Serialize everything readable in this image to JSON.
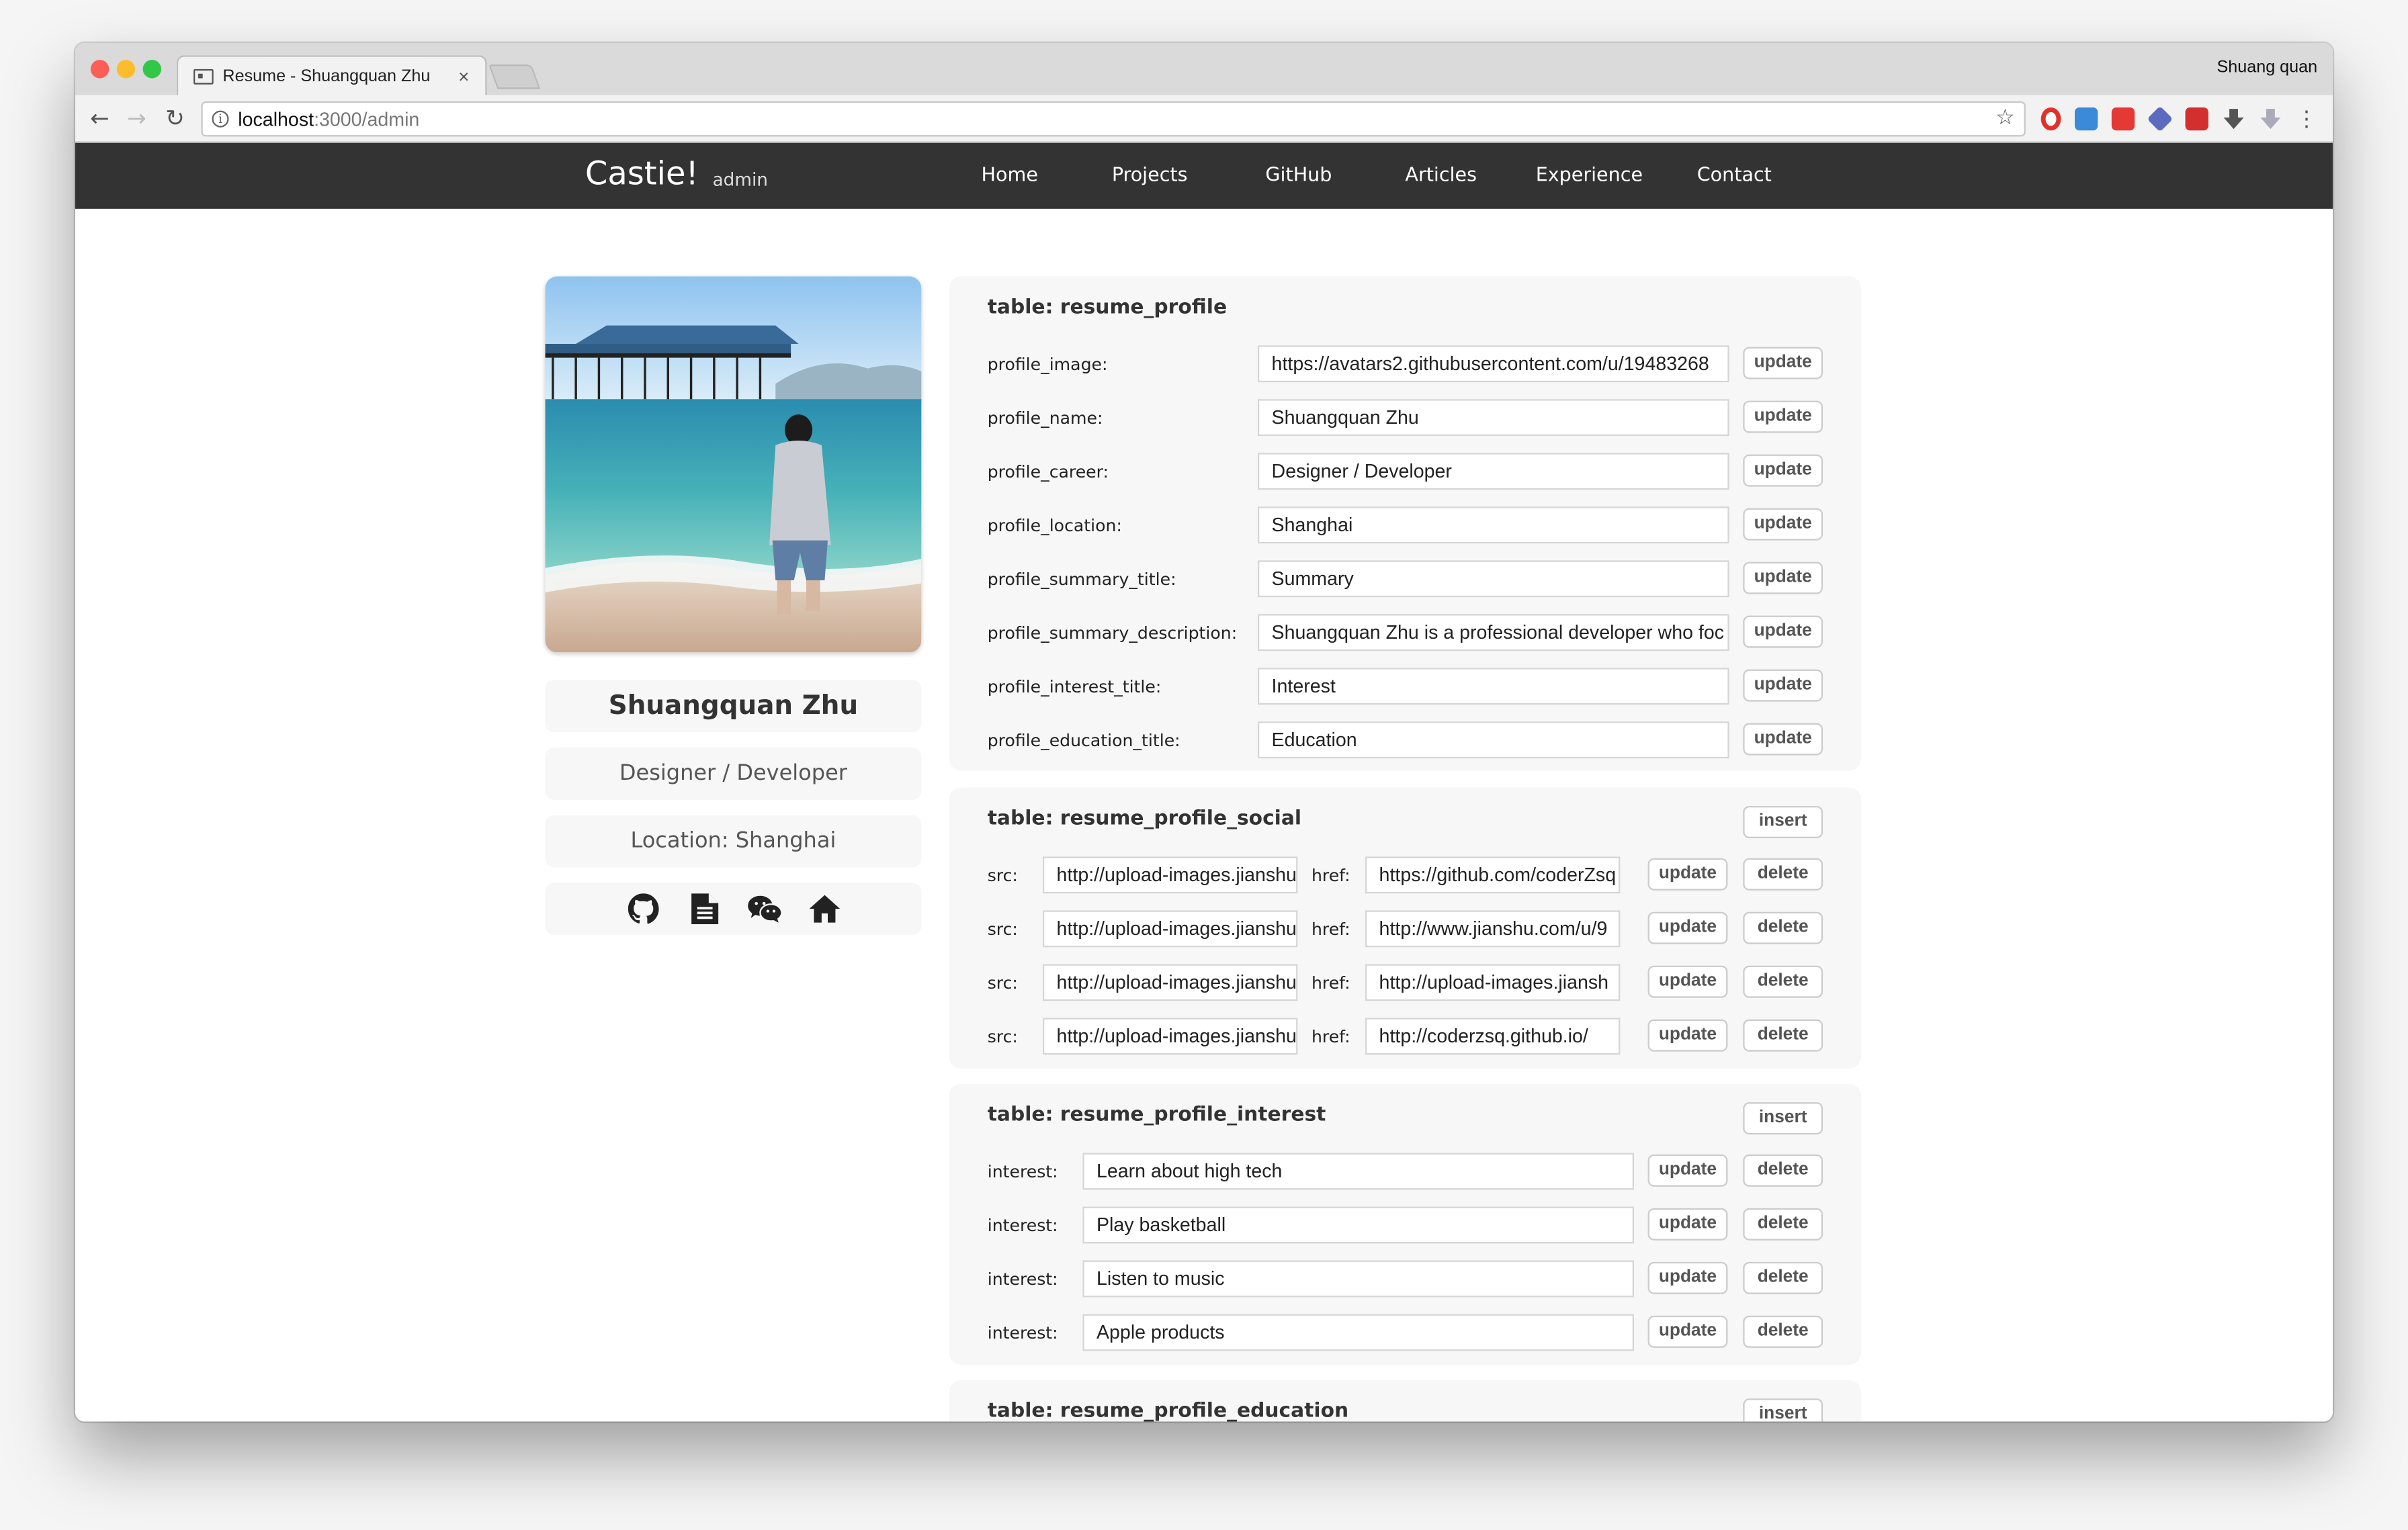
{
  "browser": {
    "tab_title": "Resume - Shuangquan Zhu",
    "tab_close": "×",
    "user_name": "Shuang quan",
    "url_host": "localhost",
    "url_path": ":3000/admin",
    "back": "←",
    "forward": "→",
    "reload": "↻",
    "star": "☆"
  },
  "site": {
    "brand": "Castie!",
    "brand_sub": "admin",
    "nav": [
      "Home",
      "Projects",
      "GitHub",
      "Articles",
      "Experience",
      "Contact"
    ]
  },
  "profile": {
    "name": "Shuangquan Zhu",
    "career": "Designer / Developer",
    "location": "Location: Shanghai",
    "social_icons": [
      "github-icon",
      "document-icon",
      "wechat-icon",
      "home-icon"
    ]
  },
  "labels": {
    "update": "update",
    "delete": "delete",
    "insert": "insert",
    "src": "src:",
    "href": "href:",
    "interest": "interest:"
  },
  "resume_profile": {
    "title": "table: resume_profile",
    "rows": [
      {
        "label": "profile_image:",
        "value": "https://avatars2.githubusercontent.com/u/19483268"
      },
      {
        "label": "profile_name:",
        "value": "Shuangquan Zhu"
      },
      {
        "label": "profile_career:",
        "value": "Designer / Developer"
      },
      {
        "label": "profile_location:",
        "value": "Shanghai"
      },
      {
        "label": "profile_summary_title:",
        "value": "Summary"
      },
      {
        "label": "profile_summary_description:",
        "value": "Shuangquan Zhu is a professional developer who foc"
      },
      {
        "label": "profile_interest_title:",
        "value": "Interest"
      },
      {
        "label": "profile_education_title:",
        "value": "Education"
      }
    ]
  },
  "resume_profile_social": {
    "title": "table: resume_profile_social",
    "rows": [
      {
        "src": "http://upload-images.jianshu",
        "href": "https://github.com/coderZsq"
      },
      {
        "src": "http://upload-images.jianshu",
        "href": "http://www.jianshu.com/u/9"
      },
      {
        "src": "http://upload-images.jianshu",
        "href": "http://upload-images.jiansh"
      },
      {
        "src": "http://upload-images.jianshu",
        "href": "http://coderzsq.github.io/"
      }
    ]
  },
  "resume_profile_interest": {
    "title": "table: resume_profile_interest",
    "rows": [
      {
        "value": "Learn about high tech"
      },
      {
        "value": "Play basketball"
      },
      {
        "value": "Listen to music"
      },
      {
        "value": "Apple products"
      }
    ]
  },
  "resume_profile_education": {
    "title": "table: resume_profile_education"
  }
}
